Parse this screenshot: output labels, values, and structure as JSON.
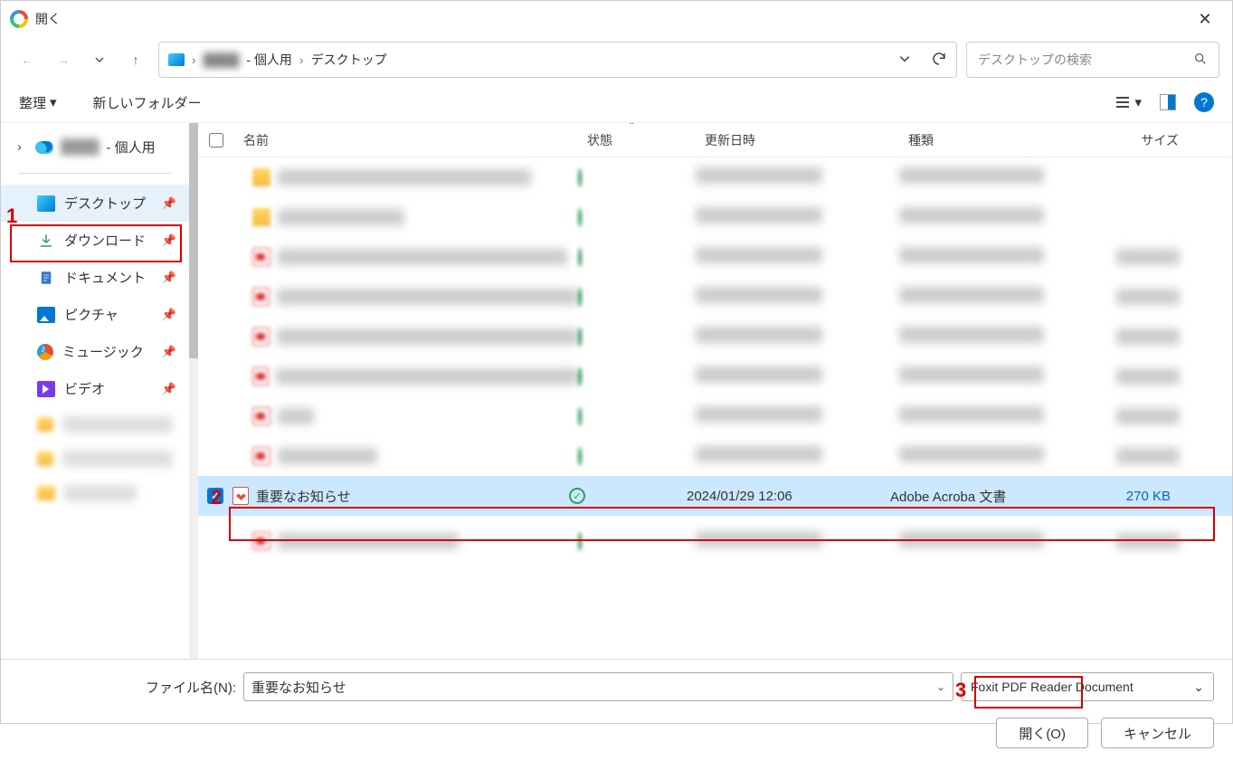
{
  "titlebar": {
    "title": "開く"
  },
  "breadcrumb": {
    "root_blur": "████",
    "personal": "- 個人用",
    "current": "デスクトップ"
  },
  "search": {
    "placeholder": "デスクトップの検索"
  },
  "toolbar": {
    "organize": "整理",
    "newfolder": "新しいフォルダー"
  },
  "tree": {
    "onedrive_blur": "████",
    "onedrive_suffix": "- 個人用"
  },
  "sidebar": {
    "desktop": "デスクトップ",
    "downloads": "ダウンロード",
    "documents": "ドキュメント",
    "pictures": "ピクチャ",
    "music": "ミュージック",
    "video": "ビデオ"
  },
  "columns": {
    "name": "名前",
    "state": "状態",
    "date": "更新日時",
    "type": "種類",
    "size": "サイズ"
  },
  "selected_file": {
    "name": "重要なお知らせ",
    "date": "2024/01/29 12:06",
    "type": "Adobe Acroba 文書",
    "size": "270 KB"
  },
  "filename_row": {
    "label": "ファイル名(N):",
    "value": "重要なお知らせ",
    "filter": "Foxit PDF Reader Document"
  },
  "buttons": {
    "open": "開く(O)",
    "cancel": "キャンセル"
  },
  "callouts": {
    "one": "1",
    "two": "2",
    "three": "3"
  },
  "blur_rows": [
    {
      "icon": "folder",
      "name_w": 280
    },
    {
      "icon": "folder",
      "name_w": 140
    },
    {
      "icon": "pdf",
      "name_w": 320
    },
    {
      "icon": "pdf",
      "name_w": 360
    },
    {
      "icon": "pdf",
      "name_w": 360
    },
    {
      "icon": "pdf",
      "name_w": 370
    },
    {
      "icon": "pdf",
      "name_w": 40
    },
    {
      "icon": "pdf",
      "name_w": 110
    }
  ],
  "blur_row_after": {
    "icon": "pdf",
    "name_w": 200
  }
}
